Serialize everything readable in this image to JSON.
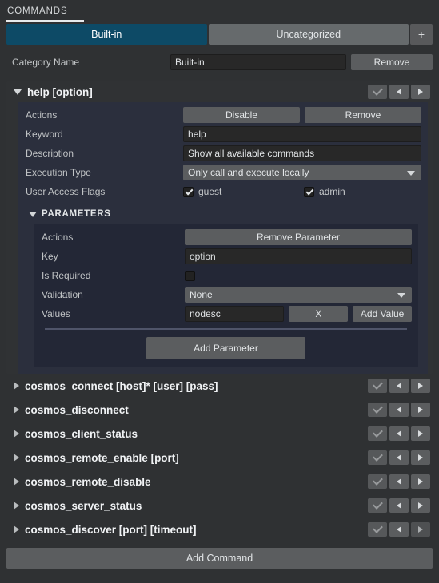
{
  "panel": {
    "title": "COMMANDS"
  },
  "tabs": {
    "items": [
      {
        "label": "Built-in",
        "active": true
      },
      {
        "label": "Uncategorized",
        "active": false
      }
    ],
    "add_label": "+"
  },
  "category": {
    "label": "Category Name",
    "value": "Built-in",
    "remove_label": "Remove"
  },
  "expanded_command": {
    "title": "help [option]",
    "controls": {
      "check": "check-icon",
      "prev": "arrow-left-icon",
      "next": "arrow-right-icon"
    },
    "fields": {
      "actions_label": "Actions",
      "disable_label": "Disable",
      "remove_label": "Remove",
      "keyword_label": "Keyword",
      "keyword_value": "help",
      "description_label": "Description",
      "description_value": "Show all available commands",
      "execution_type_label": "Execution Type",
      "execution_type_value": "Only call and execute locally",
      "execution_type_options": [
        "Only call and execute locally"
      ],
      "user_access_label": "User Access Flags",
      "flags": [
        {
          "label": "guest",
          "checked": true
        },
        {
          "label": "admin",
          "checked": true
        }
      ]
    },
    "parameters": {
      "section_title": "PARAMETERS",
      "actions_label": "Actions",
      "remove_parameter_label": "Remove Parameter",
      "key_label": "Key",
      "key_value": "option",
      "is_required_label": "Is Required",
      "is_required_checked": false,
      "validation_label": "Validation",
      "validation_value": "None",
      "validation_options": [
        "None"
      ],
      "values_label": "Values",
      "values_value": "nodesc",
      "values_remove_label": "X",
      "add_value_label": "Add Value",
      "add_parameter_label": "Add Parameter"
    }
  },
  "commands": [
    {
      "title": "cosmos_connect [host]* [user] [pass]",
      "dim_next": false
    },
    {
      "title": "cosmos_disconnect",
      "dim_next": false
    },
    {
      "title": "cosmos_client_status",
      "dim_next": false
    },
    {
      "title": "cosmos_remote_enable [port]",
      "dim_next": false
    },
    {
      "title": "cosmos_remote_disable",
      "dim_next": false
    },
    {
      "title": "cosmos_server_status",
      "dim_next": false
    },
    {
      "title": "cosmos_discover [port] [timeout]",
      "dim_next": true
    }
  ],
  "footer": {
    "add_command_label": "Add Command"
  },
  "colors": {
    "accent_tab": "#0d4a66",
    "background": "#2f3133",
    "panel": "#303234",
    "form_panel": "#2b2f3d",
    "param_panel": "#232736",
    "button": "#5b5d5f",
    "field": "#282828"
  }
}
